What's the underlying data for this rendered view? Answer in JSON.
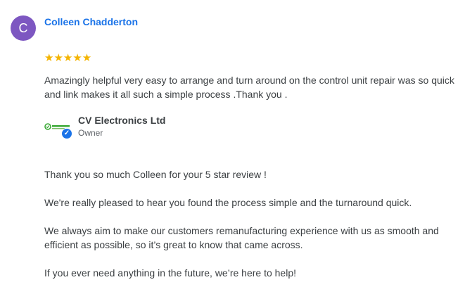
{
  "review": {
    "avatar_letter": "C",
    "avatar_color": "#7d57c1",
    "reviewer_name": "Colleen Chadderton",
    "rating": 5,
    "stars": "★★★★★",
    "text": "Amazingly helpful very easy to arrange and turn around on the control unit repair was so quick and link makes it all such a simple process .Thank you ."
  },
  "owner": {
    "name": "CV Electronics Ltd",
    "role": "Owner",
    "verified_icon": "check-badge-icon"
  },
  "reply": {
    "paragraphs": [
      "Thank you so much Colleen for your 5 star review !",
      "We're really pleased to hear you found the process simple and the turnaround quick.",
      "We always aim to make our customers remanufacturing experience with us as smooth and efficient as possible, so it’s great to know that came across.",
      "If you ever need anything in the future, we’re here to help!"
    ]
  },
  "colors": {
    "accent": "#1a73e8",
    "star": "#f4b400",
    "text": "#3c4043"
  }
}
